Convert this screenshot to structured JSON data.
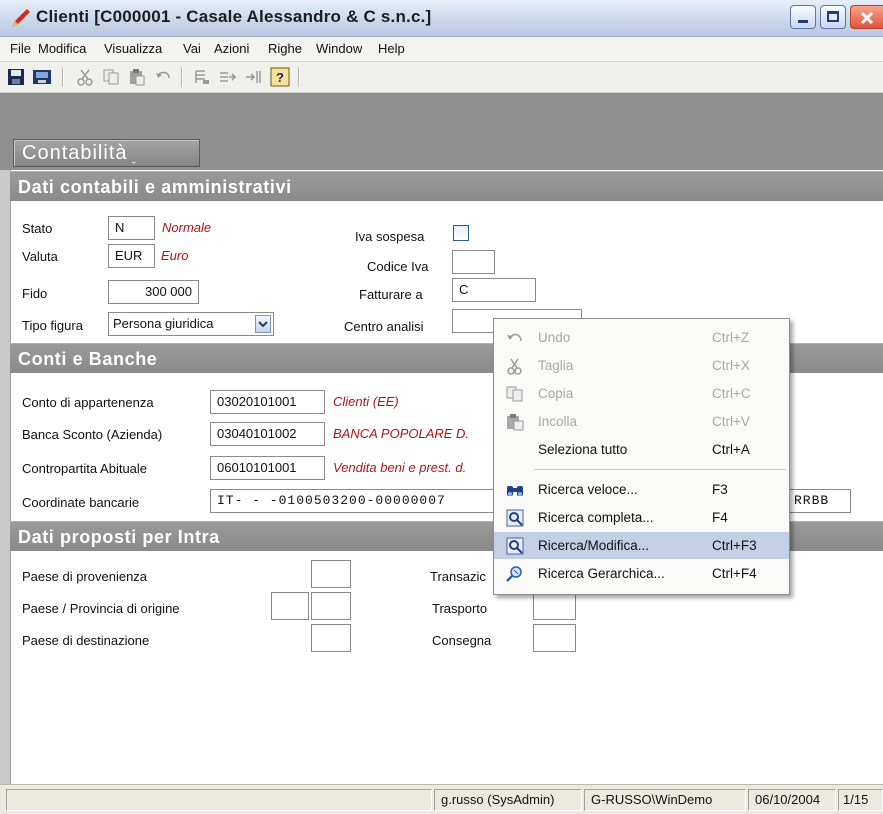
{
  "window": {
    "title": "Clienti [C000001 - Casale Alessandro & C s.n.c.]"
  },
  "menubar": [
    "File",
    "Modifica",
    "Visualizza",
    "Vai",
    "Azioni",
    "Righe",
    "Window",
    "Help"
  ],
  "toolbar": {
    "icons": [
      "save-icon",
      "save-all-icon",
      "cut-icon",
      "copy-icon",
      "paste-icon",
      "undo-icon",
      "insert-row-icon",
      "add-row-icon",
      "remove-row-icon",
      "help-icon"
    ]
  },
  "tab_button": {
    "label": "Contabilità"
  },
  "section1": {
    "title": "Dati contabili e amministrativi",
    "stato": {
      "label": "Stato",
      "value": "N",
      "desc": "Normale"
    },
    "valuta": {
      "label": "Valuta",
      "value": "EUR",
      "desc": "Euro"
    },
    "fido": {
      "label": "Fido",
      "value": "300 000"
    },
    "tipo_figura": {
      "label": "Tipo figura",
      "value": "Persona giuridica"
    },
    "iva_sospesa": {
      "label": "Iva sospesa",
      "checked": false
    },
    "codice_iva": {
      "label": "Codice Iva",
      "value": ""
    },
    "fatturare_a": {
      "label": "Fatturare a",
      "value": "C"
    },
    "centro_analisi": {
      "label": "Centro analisi",
      "value": ""
    }
  },
  "section2": {
    "title": "Conti e Banche",
    "conto_appartenenza": {
      "label": "Conto di appartenenza",
      "value": "03020101001",
      "desc": "Clienti (EE)"
    },
    "banca_sconto": {
      "label": "Banca Sconto (Azienda)",
      "value": "03040101002",
      "desc": "BANCA POPOLARE D."
    },
    "contropartita": {
      "label": "Contropartita Abituale",
      "value": "06010101001",
      "desc": "Vendita beni e prest. d."
    },
    "coordinate": {
      "label": "Coordinate bancarie",
      "value": "IT-  - -0100503200-00000007",
      "trailing": "RRBB"
    }
  },
  "section3": {
    "title": "Dati proposti per Intra",
    "paese_provenienza": {
      "label": "Paese di provenienza"
    },
    "paese_origine": {
      "label": "Paese / Provincia di origine"
    },
    "paese_destinazione": {
      "label": "Paese di destinazione"
    },
    "transazione": {
      "label": "Transazic"
    },
    "trasporto": {
      "label": "Trasporto"
    },
    "consegna": {
      "label": "Consegna"
    }
  },
  "context_menu": [
    {
      "label": "Undo",
      "shortcut": "Ctrl+Z",
      "enabled": false,
      "icon": "undo-icon"
    },
    {
      "label": "Taglia",
      "shortcut": "Ctrl+X",
      "enabled": false,
      "icon": "cut-icon"
    },
    {
      "label": "Copia",
      "shortcut": "Ctrl+C",
      "enabled": false,
      "icon": "copy-icon"
    },
    {
      "label": "Incolla",
      "shortcut": "Ctrl+V",
      "enabled": false,
      "icon": "paste-icon"
    },
    {
      "label": "Seleziona tutto",
      "shortcut": "Ctrl+A",
      "enabled": true,
      "icon": ""
    },
    {
      "label": "Ricerca veloce...",
      "shortcut": "F3",
      "enabled": true,
      "icon": "binoculars-icon"
    },
    {
      "label": "Ricerca completa...",
      "shortcut": "F4",
      "enabled": true,
      "icon": "search-form-icon"
    },
    {
      "label": "Ricerca/Modifica...",
      "shortcut": "Ctrl+F3",
      "enabled": true,
      "highlighted": true,
      "icon": "search-edit-icon"
    },
    {
      "label": "Ricerca Gerarchica...",
      "shortcut": "Ctrl+F4",
      "enabled": true,
      "icon": "tree-search-icon"
    }
  ],
  "statusbar": {
    "user": "g.russo (SysAdmin)",
    "machine": "G-RUSSO\\WinDemo",
    "date": "06/10/2004",
    "page": "1/15"
  },
  "colors": {
    "section_header": "#8f8f8f",
    "desc_text": "#b01515",
    "highlight": "#c3cfe4"
  }
}
